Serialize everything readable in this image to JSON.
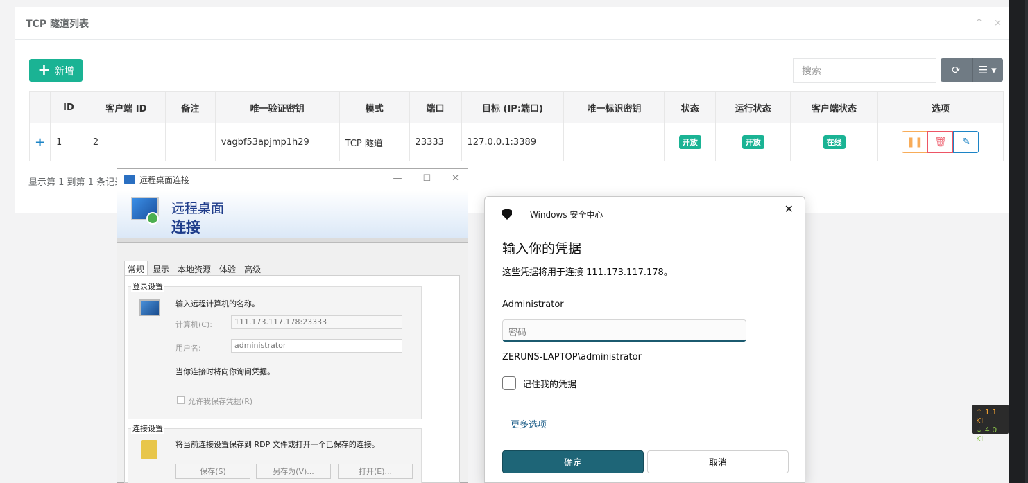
{
  "panel": {
    "title": "TCP 隧道列表",
    "tools": "^ ×",
    "add_label": "新增",
    "add_glyph": "+",
    "search_placeholder": "搜索",
    "refresh_glyph": "⟳",
    "columns_glyph": "☰ ▾",
    "page_info": "显示第 1 到第 1 条记录"
  },
  "table": {
    "headers": [
      "",
      "ID",
      "客户端 ID",
      "备注",
      "唯一验证密钥",
      "模式",
      "端口",
      "目标 (IP:端口)",
      "唯一标识密钥",
      "状态",
      "运行状态",
      "客户端状态",
      "选项"
    ],
    "row": {
      "expand": "+",
      "id": "1",
      "client_id": "2",
      "remark": "",
      "auth_key": "vagbf53apjmp1h29",
      "mode": "TCP 隧道",
      "port": "23333",
      "target": "127.0.0.1:3389",
      "unique_key": "",
      "status": "开放",
      "run_status": "开放",
      "client_status": "在线"
    },
    "op_glyphs": {
      "pause": "❚❚",
      "delete": "🗑",
      "edit": "✎"
    }
  },
  "rdp": {
    "title": "远程桌面连接",
    "banner_line1": "远程桌面",
    "banner_line2": "连接",
    "win_glyphs": {
      "min": "—",
      "max": "☐",
      "close": "✕"
    },
    "tabs": [
      "常规",
      "显示",
      "本地资源",
      "体验",
      "高级"
    ],
    "login_group": "登录设置",
    "login_hint": "输入远程计算机的名称。",
    "computer_label": "计算机(C):",
    "computer_value": "111.173.117.178:23333",
    "user_label": "用户名:",
    "user_value": "administrator",
    "cred_note": "当你连接时将向你询问凭据。",
    "allow_save": "允许我保存凭据(R)",
    "conn_group": "连接设置",
    "conn_hint": "将当前连接设置保存到 RDP 文件或打开一个已保存的连接。",
    "btn_save": "保存(S)",
    "btn_save_as": "另存为(V)...",
    "btn_open": "打开(E)..."
  },
  "security": {
    "app": "Windows 安全中心",
    "close_glyph": "✕",
    "heading": "输入你的凭据",
    "subtitle": "这些凭据将用于连接 111.173.117.178。",
    "username": "Administrator",
    "password_placeholder": "密码",
    "domain_user": "ZERUNS-LAPTOP\\administrator",
    "remember": "记住我的凭据",
    "more": "更多选项",
    "ok": "确定",
    "cancel": "取消"
  },
  "speed": {
    "up": "↑ 1.1 Ki",
    "down": "↓ 4.0 Ki"
  },
  "colors": {
    "accent": "#1ab394",
    "rdp_ok": "#1e6577"
  }
}
